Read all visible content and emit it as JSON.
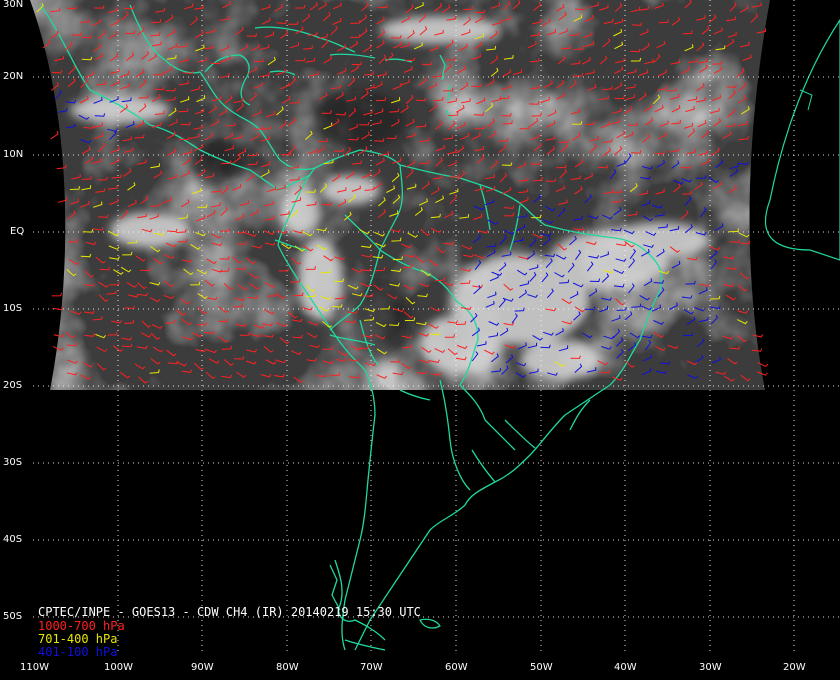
{
  "title": "CPTEC/INPE - GOES13 - CDW CH4 (IR) 20140219 15:30 UTC",
  "lat_labels": [
    "30N",
    "20N",
    "10N",
    "EQ",
    "10S",
    "20S",
    "30S",
    "40S",
    "50S"
  ],
  "lon_labels": [
    "110W",
    "100W",
    "90W",
    "80W",
    "70W",
    "60W",
    "50W",
    "40W",
    "30W",
    "20W"
  ],
  "legend": [
    {
      "label": "1000-700 hPa",
      "color": "#ff2020"
    },
    {
      "label": "701-400 hPa",
      "color": "#e8e800"
    },
    {
      "label": "401-100 hPa",
      "color": "#1010e0"
    }
  ],
  "colors": {
    "coast": "#20d8a0",
    "grid": "#ffffff",
    "background": "#000000"
  },
  "icons": [
    "wind-barb-icon"
  ]
}
